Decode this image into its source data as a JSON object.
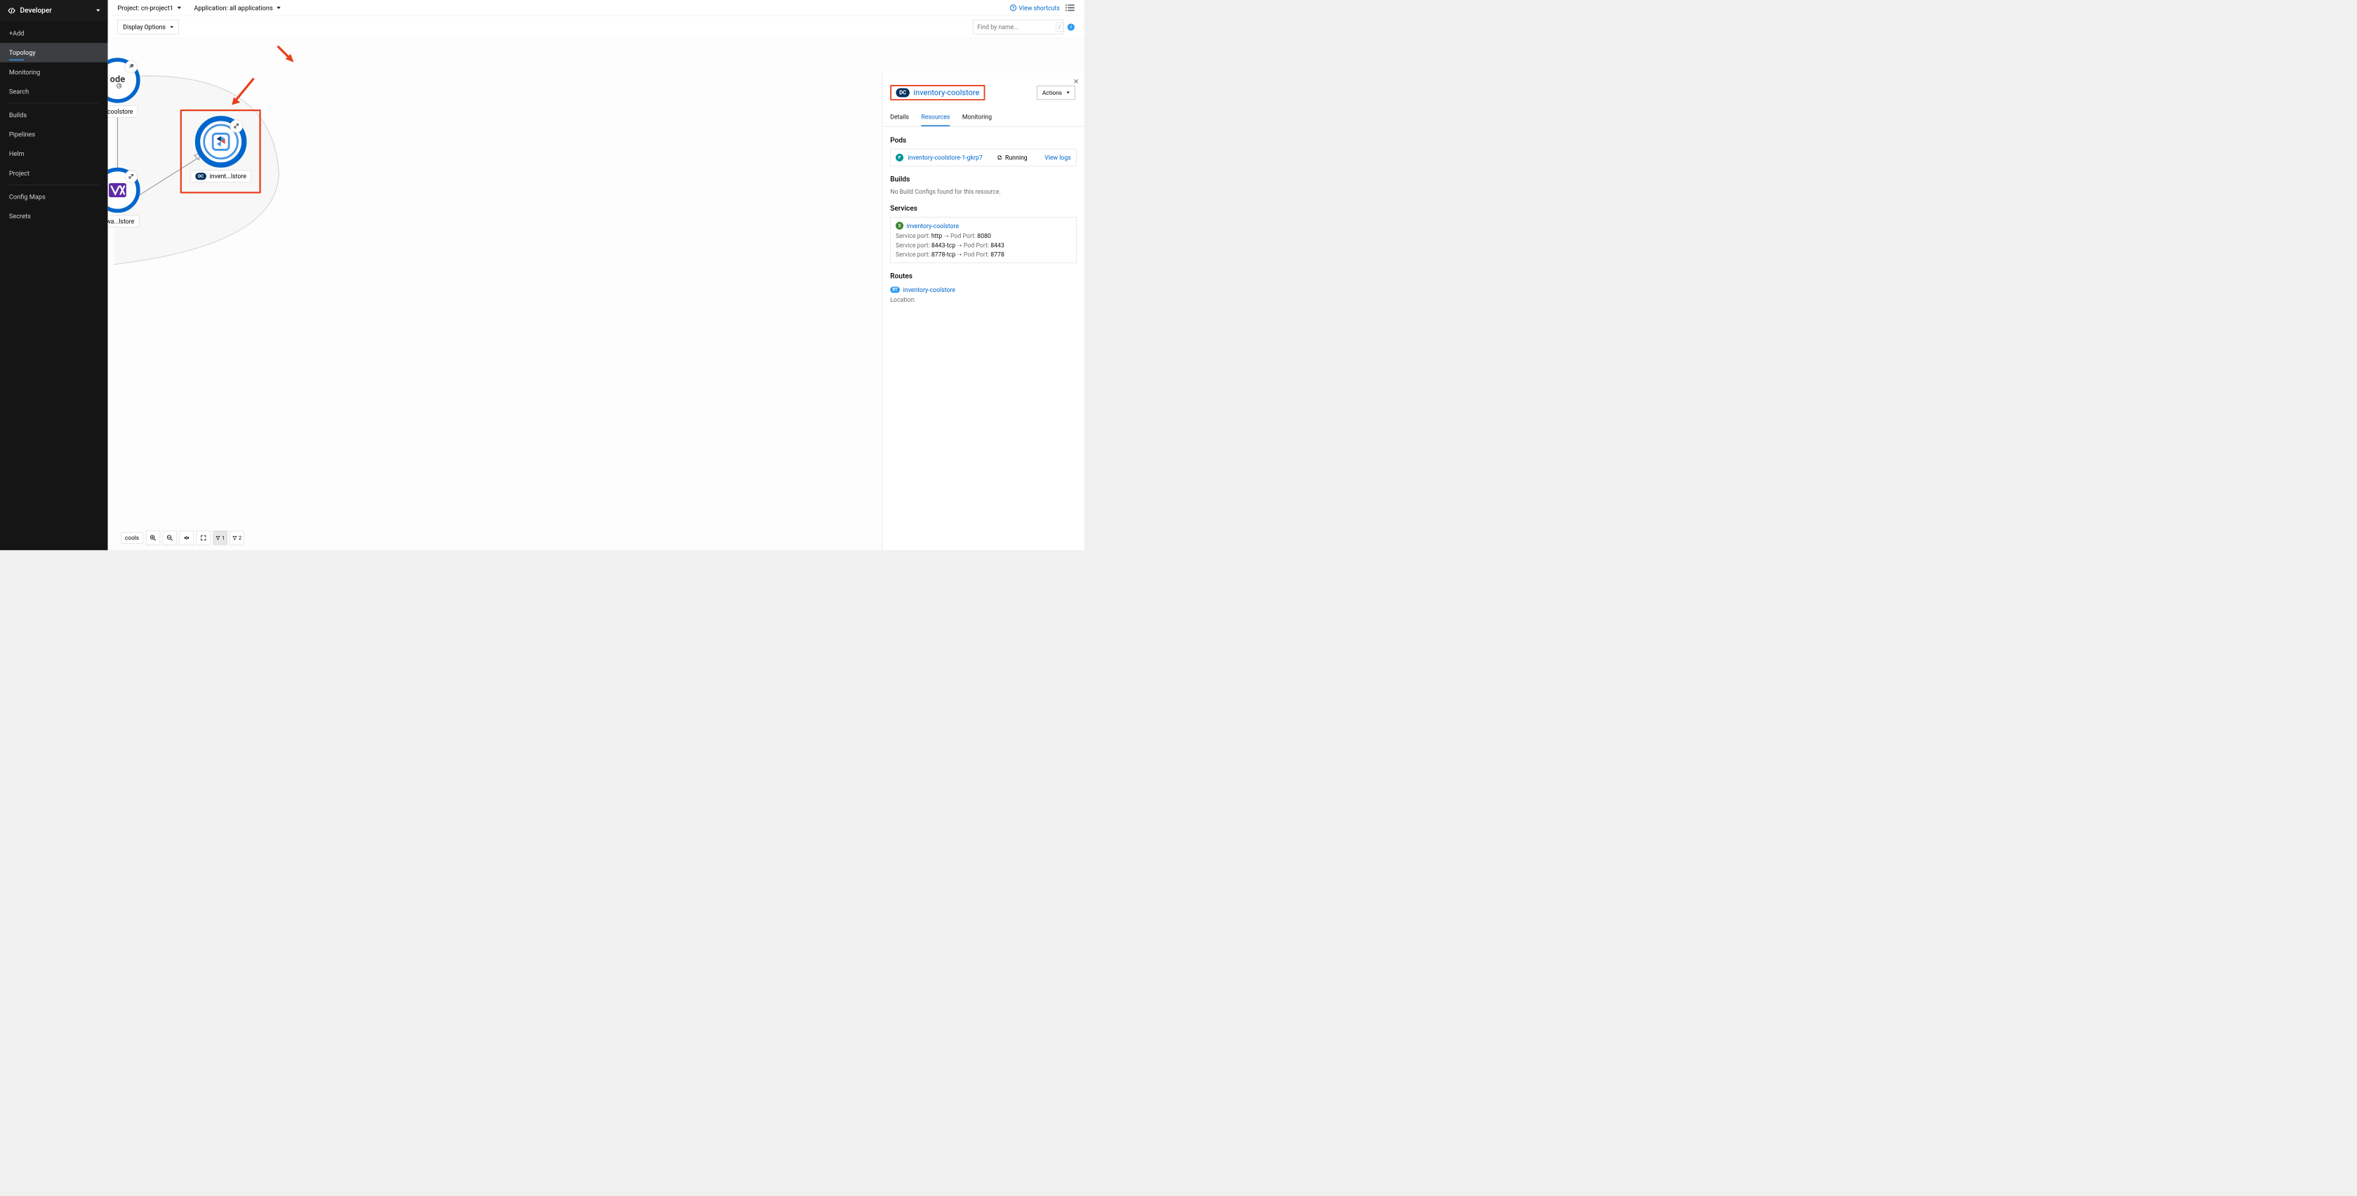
{
  "sidebar": {
    "perspective": "Developer",
    "items": [
      "+Add",
      "Topology",
      "Monitoring",
      "Search",
      "Builds",
      "Pipelines",
      "Helm",
      "Project",
      "Config Maps",
      "Secrets"
    ],
    "activeIndex": 1
  },
  "topbar": {
    "projectLabel": "Project: cn-project1",
    "applicationLabel": "Application: all applications",
    "viewShortcuts": "View shortcuts"
  },
  "toolbar": {
    "displayOptions": "Display Options",
    "findPlaceholder": "Find by name...",
    "slashKey": "/"
  },
  "canvas": {
    "nodes": {
      "top": {
        "label": "o-coolstore"
      },
      "selected": {
        "badge": "DC",
        "label": "invent...lstore"
      },
      "bottom": {
        "label": "tewa...lstore"
      },
      "peek": {
        "label": "cools"
      }
    },
    "bottomToolbar": {
      "group1": "1",
      "group2": "2"
    }
  },
  "panel": {
    "badge": "DC",
    "title": "inventory-coolstore",
    "actions": "Actions",
    "tabs": [
      "Details",
      "Resources",
      "Monitoring"
    ],
    "activeTab": 1,
    "pods": {
      "heading": "Pods",
      "name": "inventory-coolstore-1-gkrp7",
      "status": "Running",
      "viewLogs": "View logs",
      "badge": "P"
    },
    "builds": {
      "heading": "Builds",
      "empty": "No Build Configs found for this resource."
    },
    "services": {
      "heading": "Services",
      "name": "inventory-coolstore",
      "badge": "S",
      "ports": [
        {
          "labelA": "Service port:",
          "valA": "http",
          "labelB": "Pod Port:",
          "valB": "8080"
        },
        {
          "labelA": "Service port:",
          "valA": "8443-tcp",
          "labelB": "Pod Port:",
          "valB": "8443"
        },
        {
          "labelA": "Service port:",
          "valA": "8778-tcp",
          "labelB": "Pod Port:",
          "valB": "8778"
        }
      ]
    },
    "routes": {
      "heading": "Routes",
      "name": "inventory-coolstore",
      "badge": "RT",
      "locationLabel": "Location:"
    }
  }
}
